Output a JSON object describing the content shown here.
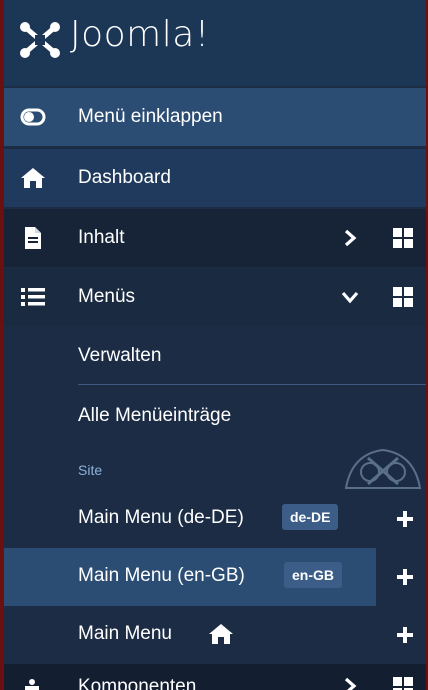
{
  "brand": {
    "name": "Joomla!",
    "name_main": "Joomla!",
    "registered": "®"
  },
  "sidebar": {
    "collapse_label": "Menü einklappen",
    "dashboard_label": "Dashboard",
    "content_label": "Inhalt",
    "menus_label": "Menüs",
    "components_label": "Komponenten",
    "menus_sub": {
      "manage_label": "Verwalten",
      "all_items_label": "Alle Menüeinträge",
      "site_label": "Site",
      "items": [
        {
          "label": "Main Menu (de-DE)",
          "badge": "de-DE"
        },
        {
          "label": "Main Menu (en-GB)",
          "badge": "en-GB"
        },
        {
          "label": "Main Menu"
        }
      ]
    }
  },
  "colors": {
    "background": "#1b2c44",
    "header": "#1c3656",
    "active": "#2c4d73",
    "badge": "#3c5d88"
  }
}
